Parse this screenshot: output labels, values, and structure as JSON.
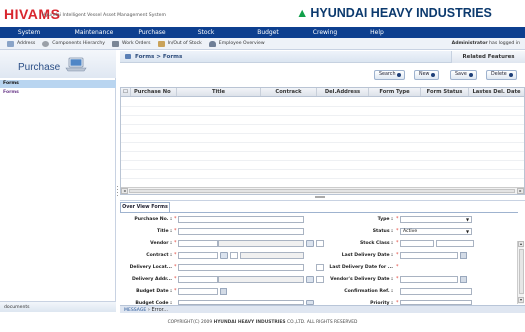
{
  "header": {
    "logo": "HIVAMS",
    "logo_subtitle": "Hyundai Intelligent Vessel Asset Management System",
    "brand": "HYUNDAI HEAVY INDUSTRIES"
  },
  "menu": [
    "System",
    "Maintenance",
    "Purchase",
    "Stock",
    "Budget",
    "Crewing",
    "Help"
  ],
  "toolbar": {
    "items": [
      "Address",
      "Components Hierarchy",
      "Work Orders",
      "In/Out of Stock",
      "Employee Overview"
    ],
    "user": "Administrator",
    "user_suffix": "has logged in"
  },
  "nav": {
    "title": "Purchase",
    "selected": "Forms",
    "item": "Forms",
    "bottom": "documents"
  },
  "content": {
    "breadcrumb": "Forms > Forms",
    "related": "Related Features",
    "buttons": [
      "Search",
      "New",
      "Save",
      "Delete"
    ],
    "grid_columns": [
      "Purchase No",
      "Title",
      "Contrack",
      "Del.Address",
      "Form Type",
      "Form Status",
      "Lastes Del. Date"
    ],
    "tab": "Over View Forms",
    "form": {
      "purchase_no": "Purchase No. :",
      "title": "Title :",
      "vendor": "Vendor :",
      "contract": "Contract :",
      "delivery_location": "Delivery Locat...",
      "delivery_address": "Delivery Addr...",
      "budget_date": "Budget Date :",
      "budget_code": "Budget Code :",
      "type": "Type :",
      "status": "Status :",
      "status_value": "Active",
      "stock_class": "Stock Class :",
      "last_delivery_date": "Last Delivery Date :",
      "last_delivery_date_for": "Last Delivery Date for ...",
      "vendors_delivery_date": "Vendor's Delivery Date :",
      "confirmation_ref": "Confirmation Ref. :",
      "priority": "Priority :"
    },
    "message_label": "MESSAGE",
    "message_text": "Error..."
  },
  "footer": {
    "prefix": "COPYRIGHT(C) 2009",
    "company": "HYUNDAI HEAVY INDUSTRIES",
    "suffix": "CO.,LTD. ALL RIGHTS RESERVED"
  },
  "colors": {
    "menu_bar": "#0d3f8f",
    "logo_red": "#d9262e",
    "brand_green": "#12a04a",
    "brand_navy": "#0c3a6e"
  }
}
